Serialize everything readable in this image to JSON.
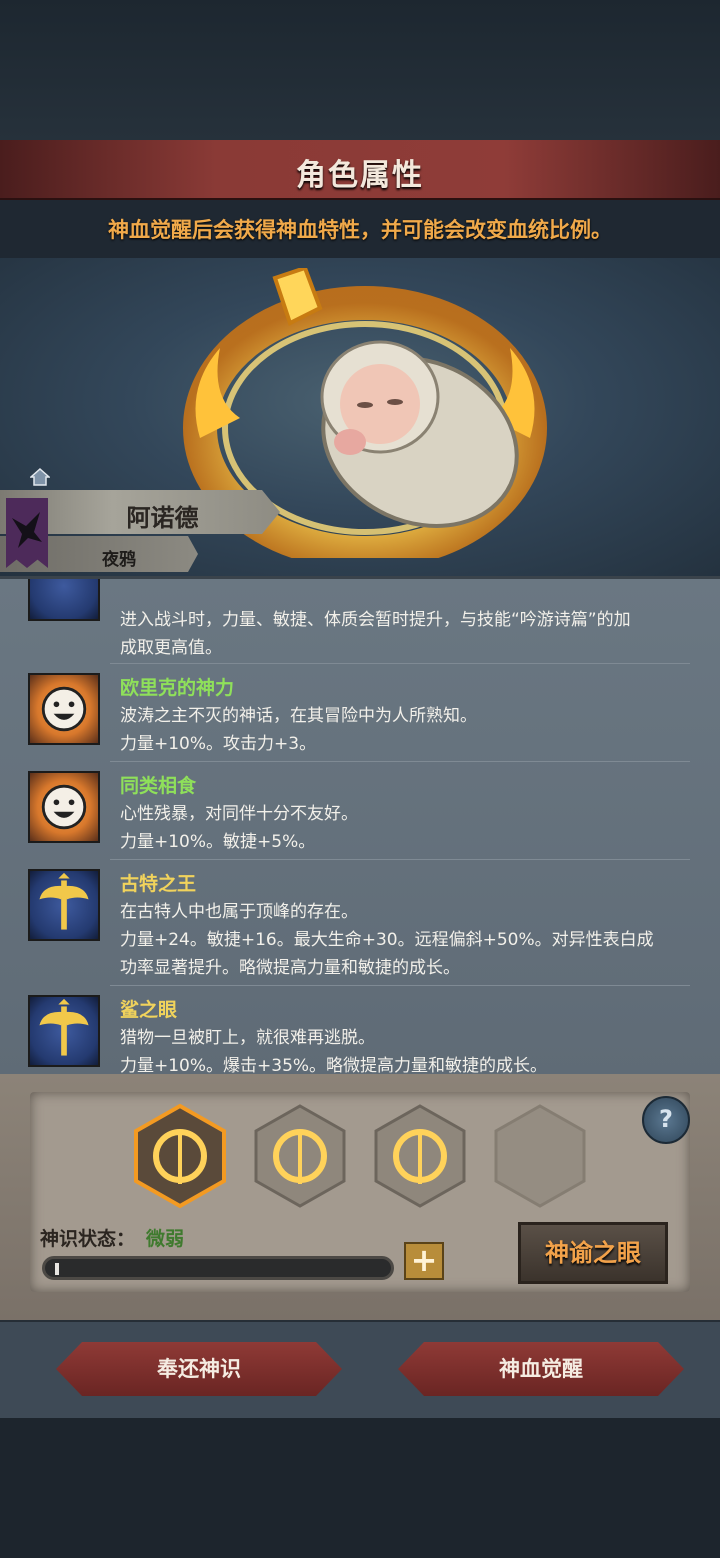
{
  "header": {
    "title": "角色属性",
    "subtitle": "神血觉醒后会获得神血特性，并可能会改变血统比例。"
  },
  "character": {
    "name": "阿诺德",
    "faction": "夜鸦"
  },
  "traits": {
    "partial_line": "进入战斗时，力量、敏捷、体质会暂时提升，与技能“吟游诗篇”的加",
    "partial_line2": "成取更高值。",
    "items": [
      {
        "name": "欧里克的神力",
        "desc": "波涛之主不灭的神话，在其冒险中为人所熟知。",
        "effect": "力量+10%。攻击力+3。",
        "effect2": "",
        "icon": "smiley-sun-icon",
        "color": "#8fe05a"
      },
      {
        "name": "同类相食",
        "desc": "心性残暴，对同伴十分不友好。",
        "effect": "力量+10%。敏捷+5%。",
        "effect2": "",
        "icon": "smiley-sun-icon",
        "color": "#8fe05a"
      },
      {
        "name": "古特之王",
        "desc": "在古特人中也属于顶峰的存在。",
        "effect": "力量+24。敏捷+16。最大生命+30。远程偏斜+50%。对异性表白成",
        "effect2": "功率显著提升。略微提高力量和敏捷的成长。",
        "icon": "double-axe-icon",
        "color": "#f1d35c"
      },
      {
        "name": "鲨之眼",
        "desc": "猎物一旦被盯上，就很难再逃脱。",
        "effect": "力量+10%。爆击+35%。略微提高力量和敏捷的成长。",
        "effect2": "",
        "icon": "double-axe-icon",
        "color": "#f1d35c"
      }
    ]
  },
  "divine": {
    "status_label": "神识状态：",
    "status_value": "微弱",
    "progress": 0.01,
    "plus_label": "+",
    "help_label": "?",
    "oracle_button": "神谕之眼",
    "slots": [
      "flame-sigil-icon",
      "flame-sigil-icon",
      "flame-sigil-icon",
      "empty-slot"
    ]
  },
  "footer": {
    "return_button": "奉还神识",
    "awaken_button": "神血觉醒"
  },
  "colors": {
    "accent": "#f0a94a",
    "title_bar": "#8a3a36",
    "green_name": "#8fe05a",
    "gold_name": "#f1d35c"
  }
}
